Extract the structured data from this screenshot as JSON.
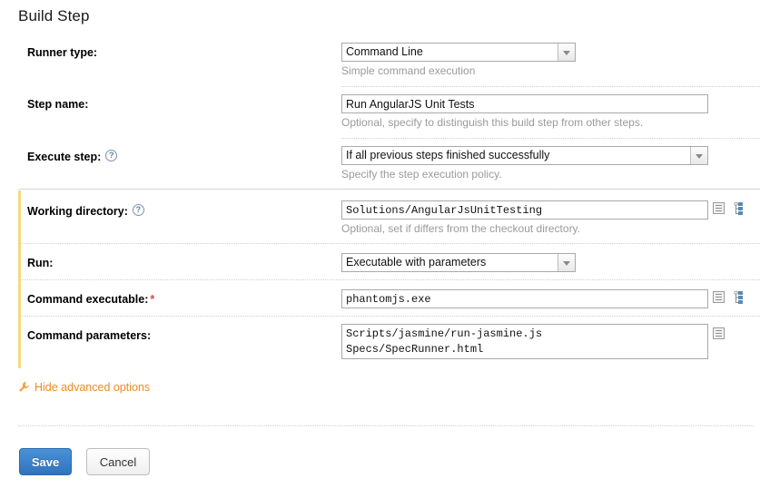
{
  "page": {
    "title": "Build Step"
  },
  "rows": {
    "runner_type": {
      "label": "Runner type:",
      "value": "Command Line",
      "hint": "Simple command execution"
    },
    "step_name": {
      "label": "Step name:",
      "value": "Run AngularJS Unit Tests",
      "placeholder": "",
      "hint": "Optional, specify to distinguish this build step from other steps."
    },
    "execute_step": {
      "label": "Execute step:",
      "help_icon": "help-icon",
      "value": "If all previous steps finished successfully",
      "hint": "Specify the step execution policy."
    },
    "working_directory": {
      "label": "Working directory:",
      "help_icon": "help-icon",
      "value": "Solutions/AngularJsUnitTesting",
      "placeholder": "",
      "hint": "Optional, set if differs from the checkout directory.",
      "icons": [
        "edit-lines-icon",
        "tree-browse-icon"
      ]
    },
    "run": {
      "label": "Run:",
      "value": "Executable with parameters",
      "hint": ""
    },
    "command_executable": {
      "label": "Command executable:",
      "required_marker": "*",
      "value": "phantomjs.exe",
      "placeholder": "",
      "hint": "",
      "icons": [
        "edit-lines-icon",
        "tree-browse-icon"
      ]
    },
    "command_parameters": {
      "label": "Command parameters:",
      "value": "Scripts/jasmine/run-jasmine.js\nSpecs/SpecRunner.html",
      "placeholder": "",
      "hint": "",
      "icons": [
        "edit-lines-icon"
      ]
    }
  },
  "advanced_toggle": {
    "label": "Hide advanced options",
    "icon": "wrench-icon"
  },
  "footer": {
    "save_label": "Save",
    "cancel_label": "Cancel"
  },
  "colors": {
    "accent_orange": "#f08a1e",
    "advanced_bar": "#f5d97b",
    "primary_button": "#2f73bd",
    "required_star": "#dd4444",
    "hint_text": "#9a9a9a"
  }
}
